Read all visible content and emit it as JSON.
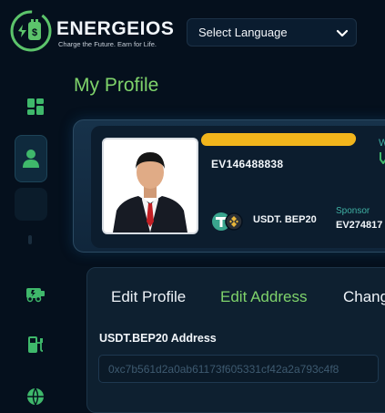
{
  "header": {
    "brand": "ENERGEIOS",
    "tagline": "Charge the Future. Earn for Life.",
    "language_select": "Select Language"
  },
  "page": {
    "title": "My Profile"
  },
  "profile": {
    "user_id": "EV146488838",
    "wallet_label": "USDT. BEP20",
    "sponsor_label": "Sponsor",
    "sponsor_id": "EV274817",
    "right_label": "W"
  },
  "edit": {
    "tabs": [
      "Edit Profile",
      "Edit Address",
      "Chang"
    ],
    "field_label": "USDT.BEP20 Address",
    "address_value": "0xc7b561d2a0ab61173f605331cf42a2a793c4f8"
  },
  "colors": {
    "accent_green": "#7fd36b",
    "teal": "#3fb1a4",
    "redaction": "#f2b51c"
  }
}
